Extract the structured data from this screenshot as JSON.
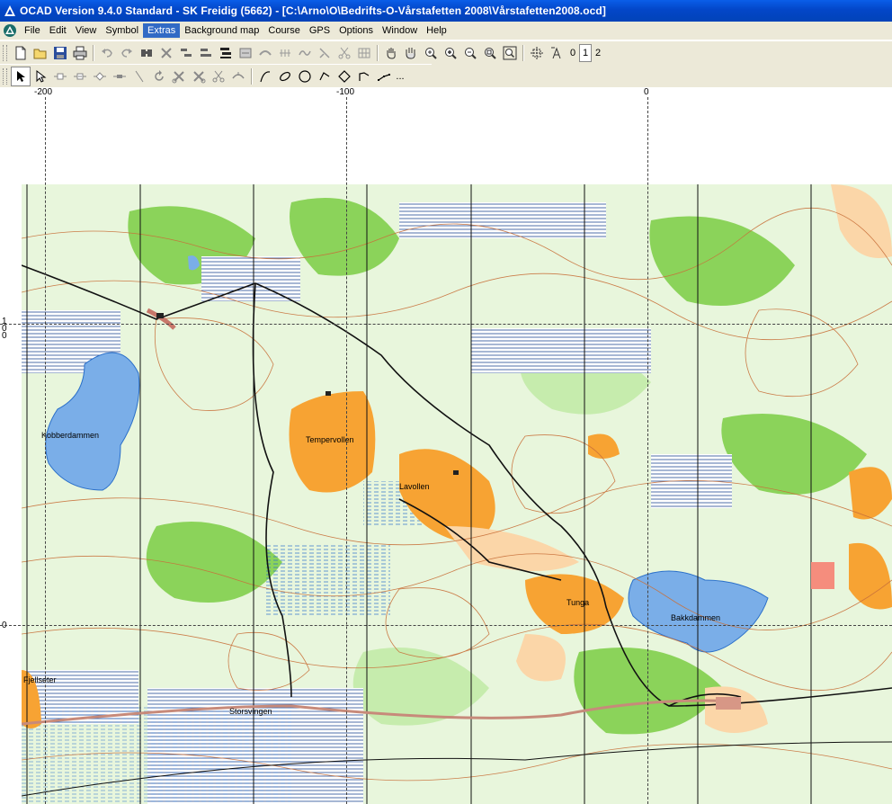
{
  "window": {
    "title": "OCAD Version 9.4.0  Standard - SK Freidig (5662) - [C:\\Arno\\O\\Bedrifts-O-Vårstafetten 2008\\Vårstafetten2008.ocd]"
  },
  "menu": {
    "items": [
      "File",
      "Edit",
      "View",
      "Symbol",
      "Extras",
      "Background map",
      "Course",
      "GPS",
      "Options",
      "Window",
      "Help"
    ],
    "active": "Extras"
  },
  "toolbar": {
    "main_icons": [
      "new-icon",
      "open-icon",
      "save-icon",
      "print-icon",
      "undo-icon",
      "redo-icon",
      "find-icon",
      "delete-icon",
      "align-icon",
      "align-bottom-icon",
      "align-stack-icon",
      "symbol-icon",
      "bridge-icon",
      "fence-icon",
      "smooth-icon",
      "cut-icon",
      "scissors-icon",
      "grid-icon",
      "hand-icon",
      "move-icon",
      "zoom-in-icon",
      "zoom-in-plus-icon",
      "zoom-out-icon",
      "zoom-fit-icon",
      "zoom-area-icon",
      "crosshair-icon",
      "text-icon"
    ],
    "view_buttons": [
      "0",
      "1",
      "2"
    ],
    "view_pressed": "1"
  },
  "draw_toolbar": {
    "icons": [
      "arrow-select-icon",
      "edit-point-icon",
      "add-point-icon",
      "delete-point-icon",
      "corner-point-icon",
      "dash-point-icon",
      "line-icon",
      "rotate-icon",
      "cut-obj-icon",
      "cut-hole-icon",
      "clip-icon",
      "split-icon",
      "curve-icon",
      "ellipse-icon",
      "circle-icon",
      "rect-icon",
      "polygon-icon",
      "freehand-icon",
      "straight-line-icon"
    ],
    "more_label": "..."
  },
  "ruler": {
    "labels": [
      "-200",
      "-100",
      "0"
    ]
  },
  "vruler": {
    "labels": [
      "1",
      "0",
      "0",
      "0"
    ]
  },
  "map": {
    "places": [
      "Kobberdammen",
      "Tempervollen",
      "Lavollen",
      "Tunga",
      "Bakkdammen",
      "Fjellseter",
      "Storsvingen"
    ],
    "colors": {
      "forest_green": "#8bd35a",
      "light_green": "#c6ecad",
      "open_orange": "#f7a333",
      "rough_open": "#fbd6a8",
      "water_blue": "#7aaee8",
      "contour_brown": "#c8703a",
      "marsh_blue": "#2a6fc9",
      "road_black": "#111111"
    }
  }
}
